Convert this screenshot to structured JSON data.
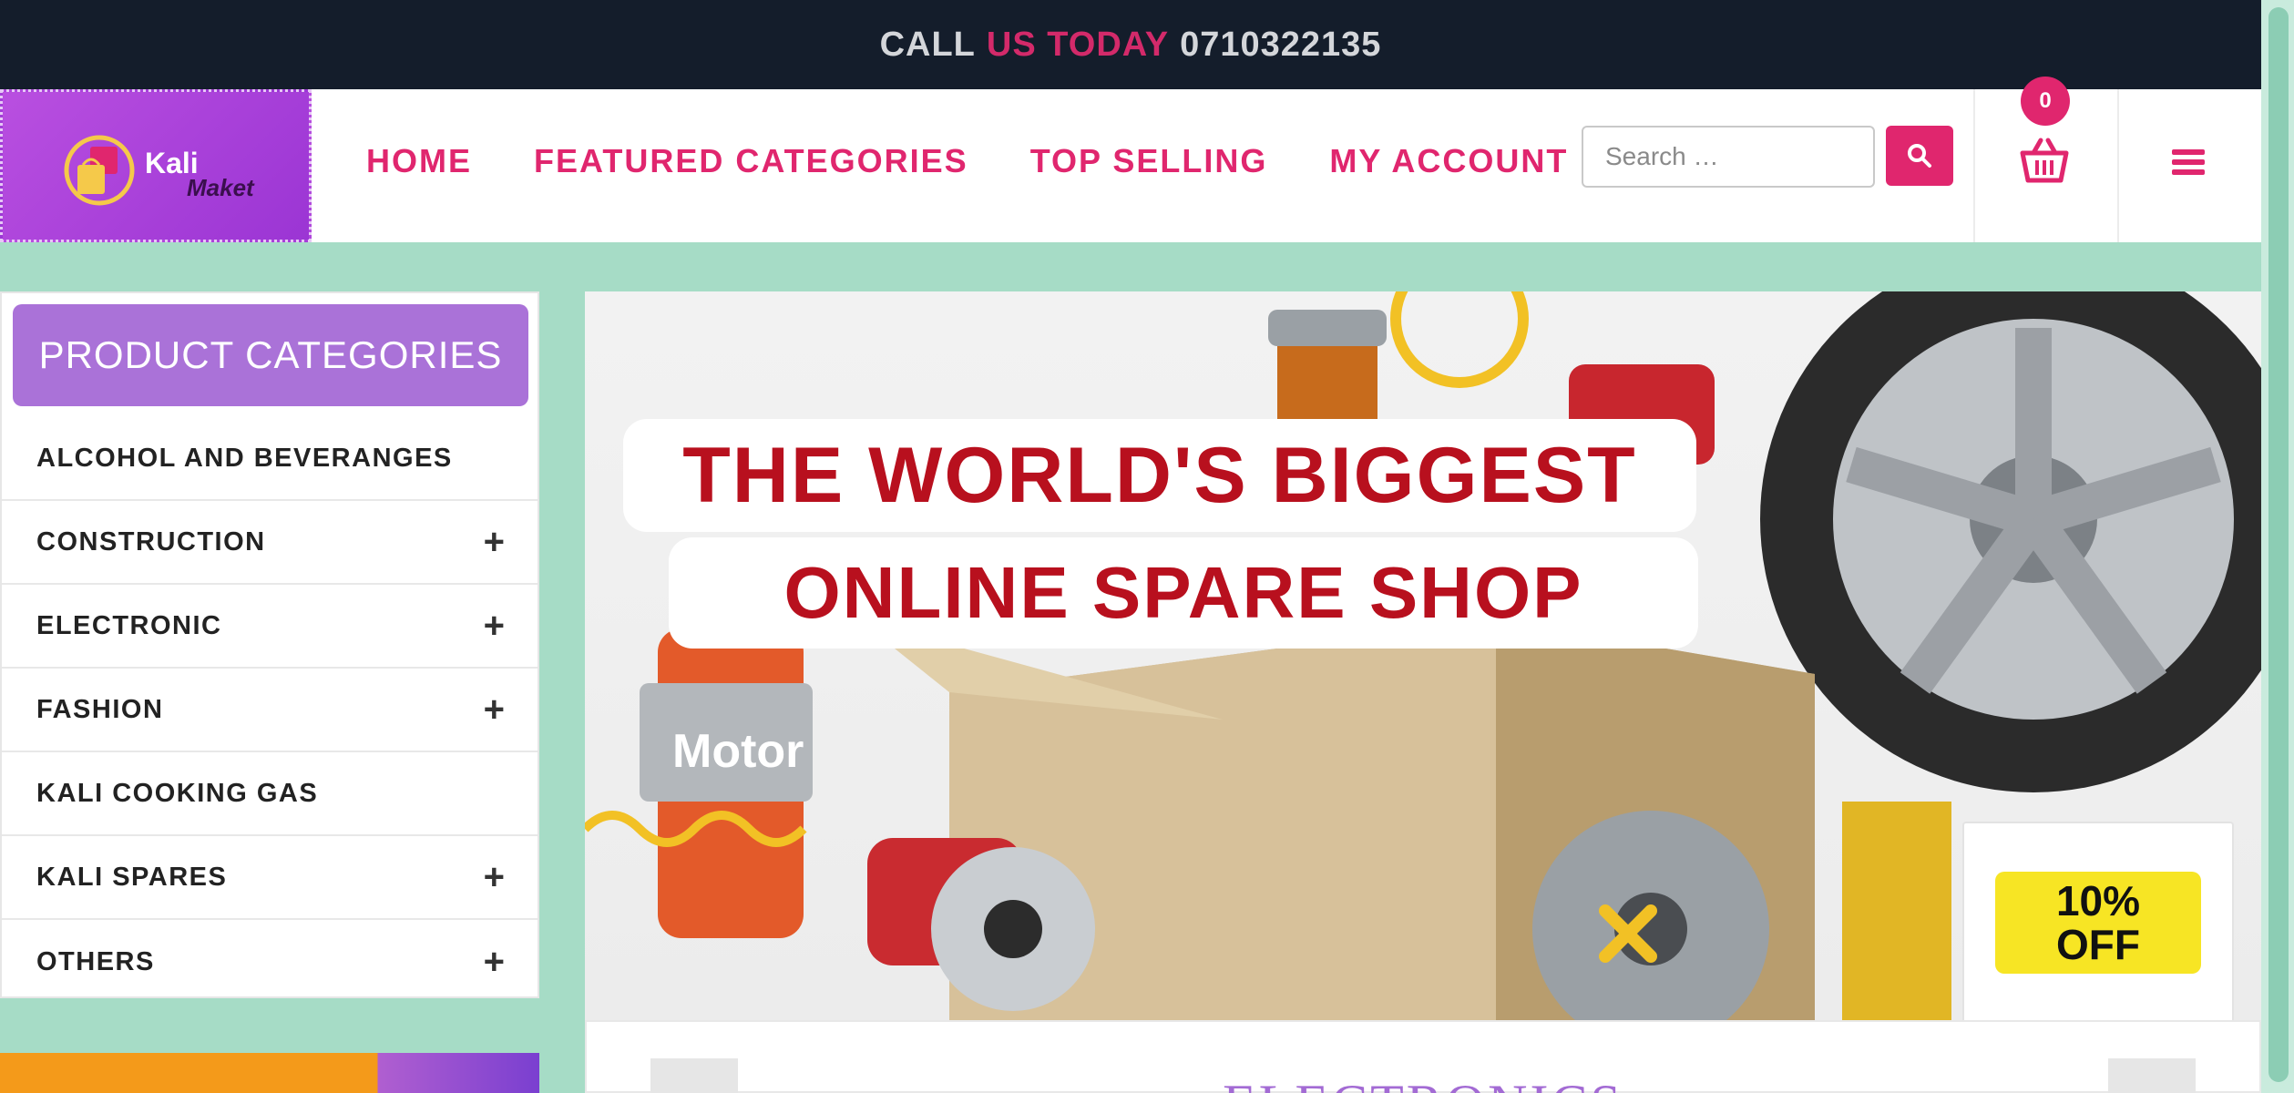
{
  "topbar": {
    "call": "CALL",
    "us_today": "US TODAY",
    "phone": "0710322135"
  },
  "header": {
    "logo": {
      "name": "Kali",
      "tagline": "Maket"
    },
    "nav": [
      {
        "label": "HOME"
      },
      {
        "label": "FEATURED CATEGORIES"
      },
      {
        "label": "TOP SELLING"
      },
      {
        "label": "MY ACCOUNT"
      }
    ],
    "search": {
      "placeholder": "Search …"
    },
    "cart_count": "0",
    "icons": {
      "search": "search-icon",
      "cart": "basket-icon",
      "menu": "hamburger-menu-icon"
    }
  },
  "sidebar": {
    "title": "PRODUCT CATEGORIES",
    "items": [
      {
        "label": "ALCOHOL AND BEVERANGES",
        "expand": ""
      },
      {
        "label": "CONSTRUCTION",
        "expand": "+"
      },
      {
        "label": "ELECTRONIC",
        "expand": "+"
      },
      {
        "label": "FASHION",
        "expand": "+"
      },
      {
        "label": "KALI COOKING GAS",
        "expand": ""
      },
      {
        "label": "KALI SPARES",
        "expand": "+"
      },
      {
        "label": "OTHERS",
        "expand": "+"
      }
    ]
  },
  "banner": {
    "line1": "THE WORLD'S BIGGEST",
    "line2": "ONLINE SPARE SHOP",
    "badge_line1": "10%",
    "badge_line2": "OFF",
    "jar_label": "Motor"
  },
  "electronics": {
    "title": "ELECTRONICS"
  },
  "colors": {
    "accent": "#e0266e",
    "topbar_bg": "#141d2b",
    "logo_bg": "#9b35d4",
    "category_title_bg": "#aa72d8",
    "page_bg": "#a6dcc6",
    "banner_text": "#b8101e"
  }
}
